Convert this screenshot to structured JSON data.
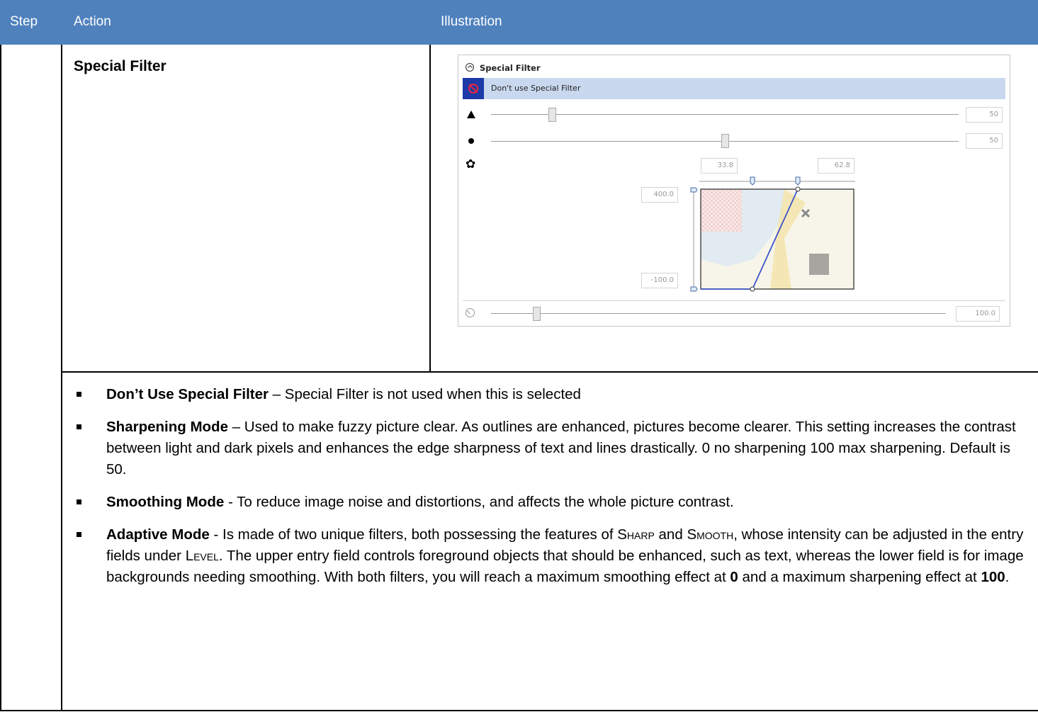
{
  "header": {
    "step": "Step",
    "action": "Action",
    "illustration": "Illustration"
  },
  "action": {
    "title": "Special Filter"
  },
  "illustration": {
    "panel_title": "Special Filter",
    "selected_option": "Don't use Special Filter",
    "sharpen_value": "50",
    "smooth_value": "50",
    "adaptive_upper": "33.8",
    "adaptive_lower_x": "62.8",
    "y_top": "400.0",
    "y_bottom": "-100.0",
    "gauge_value": "100.0",
    "sharpen_level": 0.13,
    "smooth_level": 0.5,
    "gauge_level": 0.1,
    "icons": [
      "collapse-icon",
      "no-entry-icon",
      "triangle-icon",
      "dot-icon",
      "gear-icon",
      "gauge-icon"
    ]
  },
  "bullets": [
    {
      "term": "Don’t Use Special Filter",
      "sep": " – ",
      "text": "Special Filter is not used when this is selected"
    },
    {
      "term": "Sharpening Mode",
      "sep": " – ",
      "text": "Used to make fuzzy picture clear. As outlines are enhanced, pictures become clearer. This setting increases the contrast between light and dark pixels and enhances the edge sharpness of text and lines drastically. 0 no sharpening 100 max sharpening. Default is 50."
    },
    {
      "term": "Smoothing Mode",
      "sep": " - ",
      "text": "To reduce image noise and distortions, and affects the whole picture contrast."
    },
    {
      "term": "Adaptive Mode",
      "sep": " - ",
      "text_a": "Is made of two unique filters, both possessing the features of ",
      "sharp": "Sharp",
      "and": " and ",
      "smooth": "Smooth",
      "text_b": ", whose intensity can be adjusted in the entry fields under ",
      "level": "Level",
      "text_c": ". The upper entry field controls foreground objects that should be enhanced, such as text, whereas the lower field is for image backgrounds needing smoothing. With both filters, you will reach a maximum smoothing effect at ",
      "zero": "0",
      "text_d": " and a maximum sharpening effect at ",
      "hundred": "100",
      "end": "."
    }
  ]
}
